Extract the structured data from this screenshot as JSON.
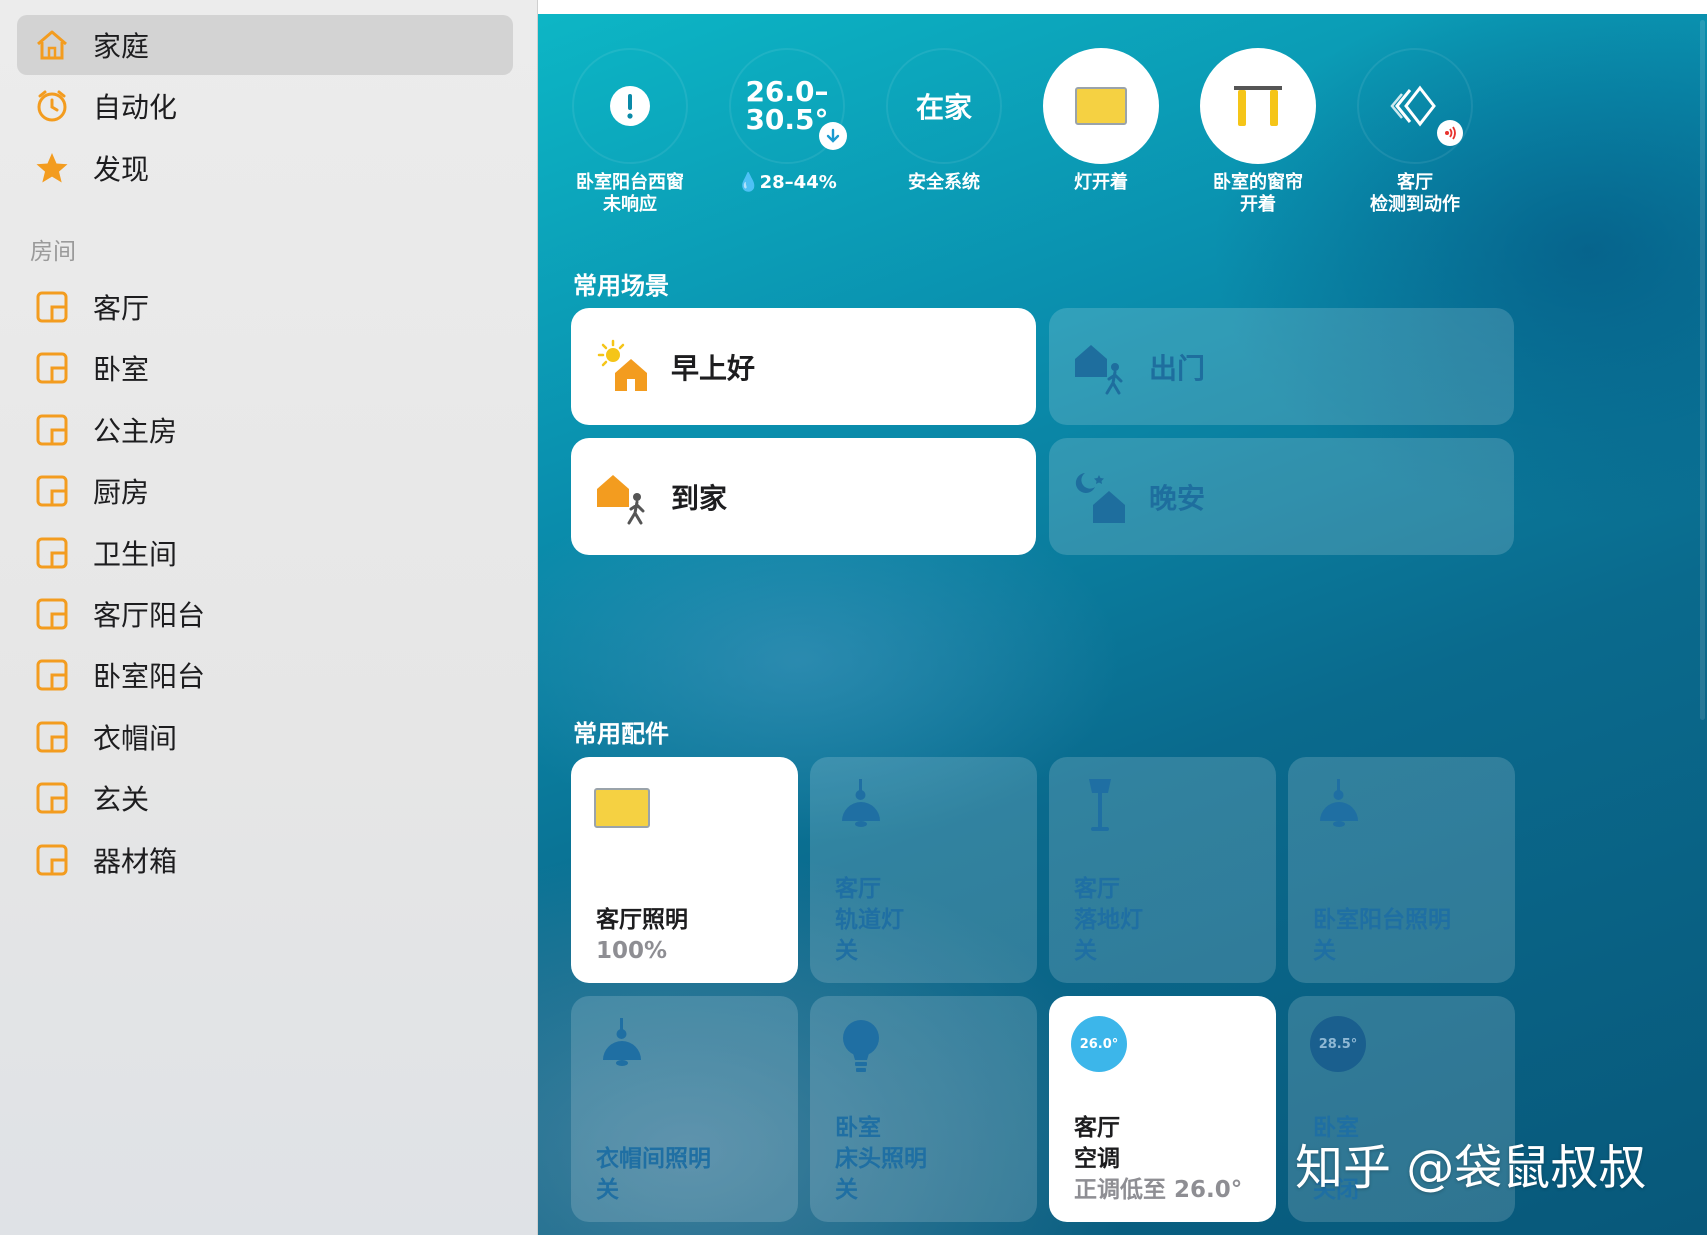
{
  "sidebar": {
    "nav": [
      {
        "label": "家庭",
        "icon": "house-icon",
        "selected": true
      },
      {
        "label": "自动化",
        "icon": "clock-icon",
        "selected": false
      },
      {
        "label": "发现",
        "icon": "star-icon",
        "selected": false
      }
    ],
    "rooms_title": "房间",
    "rooms": [
      "客厅",
      "卧室",
      "公主房",
      "厨房",
      "卫生间",
      "客厅阳台",
      "卧室阳台",
      "衣帽间",
      "玄关",
      "器材箱"
    ]
  },
  "status_bar": [
    {
      "kind": "alert",
      "caption": [
        "卧室阳台西窗",
        "未响应"
      ]
    },
    {
      "kind": "climate",
      "value": [
        "26.0–",
        "30.5°"
      ],
      "caption": [
        "💧28–44%"
      ]
    },
    {
      "kind": "security",
      "value": "在家",
      "caption": [
        "安全系统"
      ]
    },
    {
      "kind": "light",
      "caption": [
        "灯开着"
      ]
    },
    {
      "kind": "curtain",
      "caption": [
        "卧室的窗帘",
        "开着"
      ]
    },
    {
      "kind": "motion",
      "caption": [
        "客厅",
        "检测到动作"
      ]
    }
  ],
  "scenes_title": "常用场景",
  "scenes": [
    {
      "label": "早上好",
      "on": true,
      "icon": "good-morning-icon"
    },
    {
      "label": "出门",
      "on": false,
      "icon": "leave-home-icon"
    },
    {
      "label": "到家",
      "on": true,
      "icon": "arrive-home-icon"
    },
    {
      "label": "晚安",
      "on": false,
      "icon": "good-night-icon"
    }
  ],
  "accessories_title": "常用配件",
  "accessories": [
    {
      "lines": [
        "客厅照明"
      ],
      "status": "100%",
      "on": true,
      "icon": "light-panel-icon"
    },
    {
      "lines": [
        "客厅",
        "轨道灯"
      ],
      "status": "关",
      "on": false,
      "icon": "pendant-lamp-icon"
    },
    {
      "lines": [
        "客厅",
        "落地灯"
      ],
      "status": "关",
      "on": false,
      "icon": "floor-lamp-icon"
    },
    {
      "lines": [
        "卧室阳台照明"
      ],
      "status": "关",
      "on": false,
      "icon": "pendant-lamp-icon"
    },
    {
      "lines": [
        "衣帽间照明"
      ],
      "status": "关",
      "on": false,
      "icon": "pendant-lamp-icon"
    },
    {
      "lines": [
        "卧室",
        "床头照明"
      ],
      "status": "关",
      "on": false,
      "icon": "bulb-icon"
    },
    {
      "lines": [
        "客厅",
        "空调"
      ],
      "status": "正调低至 26.0°",
      "on": true,
      "icon": "thermostat-icon",
      "badge": "26.0°"
    },
    {
      "lines": [
        "卧室"
      ],
      "status": "关闭",
      "on": false,
      "icon": "thermostat-icon",
      "badge": "28.5°"
    }
  ],
  "colors": {
    "accent": "#f39c1f",
    "off_text": "#1f6fa3",
    "light_yellow": "#f5d142"
  },
  "watermark": "知乎 @袋鼠叔叔"
}
